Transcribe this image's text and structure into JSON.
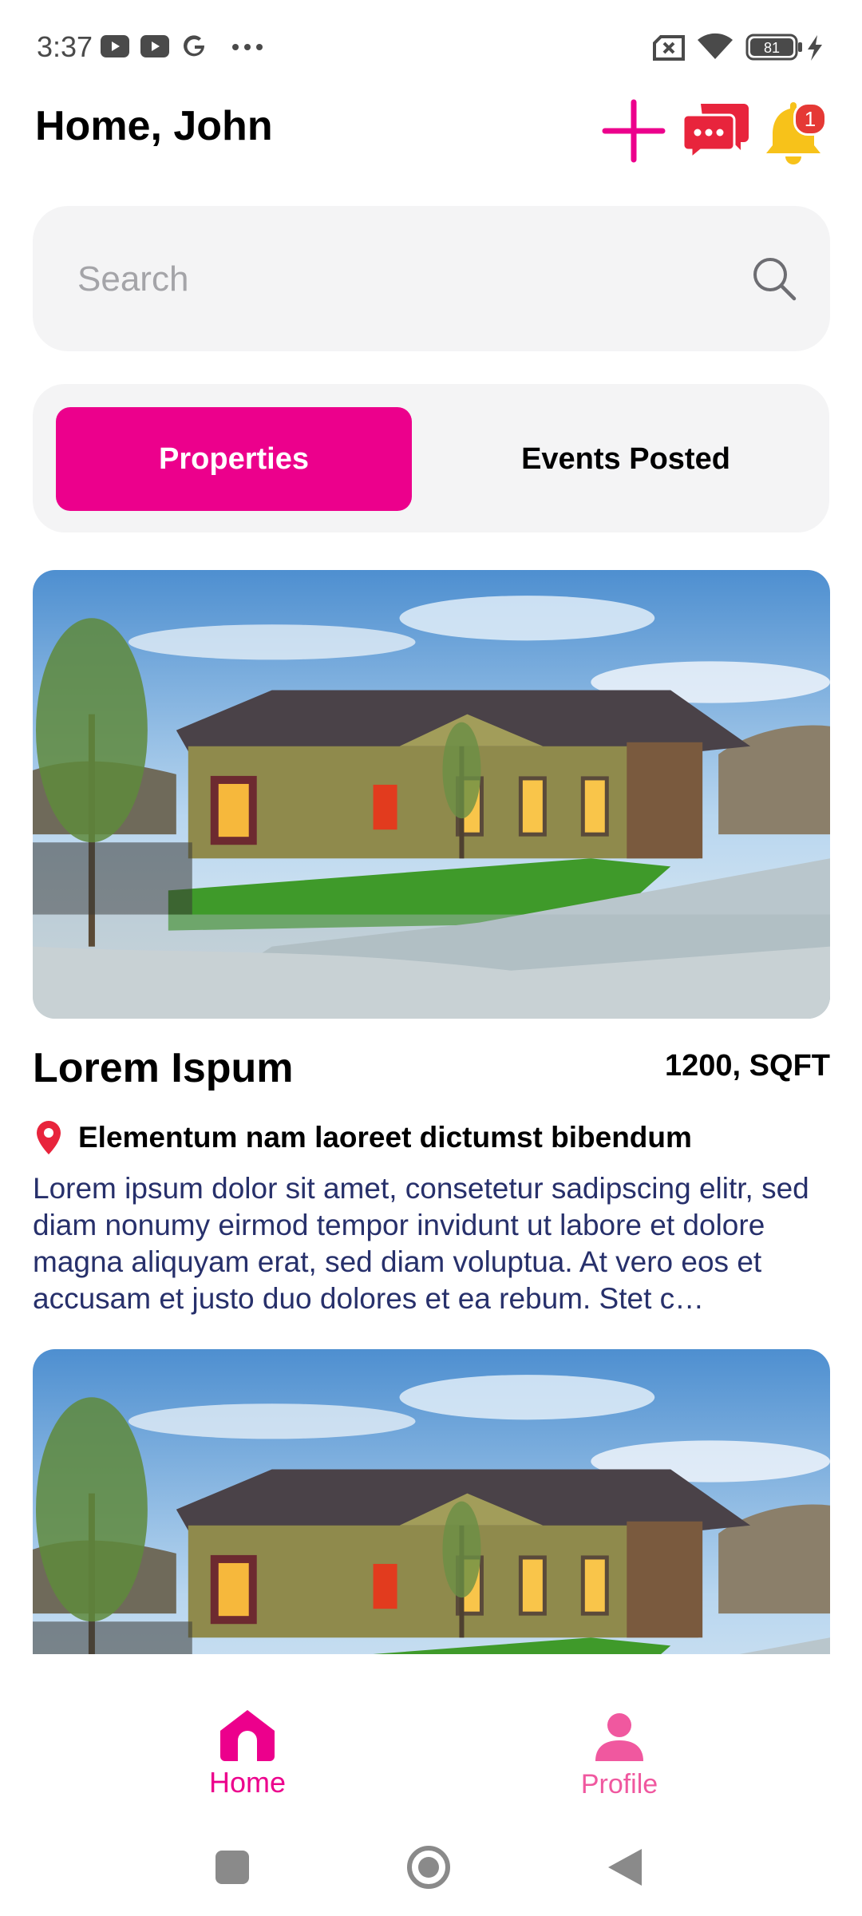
{
  "status_bar": {
    "time": "3:37",
    "left_icons": [
      "youtube-icon",
      "youtube-icon",
      "google-icon",
      "more-dots-icon"
    ],
    "right_icons": [
      "no-sim-icon",
      "wifi-icon",
      "battery-icon",
      "charging-icon"
    ],
    "battery_level": "81"
  },
  "header": {
    "title": "Home, John",
    "notification_count": "1"
  },
  "search": {
    "placeholder": "Search"
  },
  "tabs": [
    {
      "label": "Properties",
      "active": true
    },
    {
      "label": "Events Posted",
      "active": false
    }
  ],
  "listings": [
    {
      "title": "Lorem Ispum",
      "size": "1200, SQFT",
      "address": "Elementum nam laoreet dictumst bibendum",
      "description": "Lorem ipsum dolor sit amet, consetetur sadipscing elitr, sed diam nonumy eirmod tempor invidunt ut labore et dolore magna aliquyam erat, sed diam voluptua. At vero eos et accusam et justo duo dolores et ea rebum. Stet c…"
    }
  ],
  "bottom_nav": {
    "home_label": "Home",
    "profile_label": "Profile"
  },
  "colors": {
    "accent": "#ec008c",
    "chat": "#e8243c",
    "bell": "#f7c21a",
    "badge": "#e53935",
    "description_text": "#27306b"
  }
}
